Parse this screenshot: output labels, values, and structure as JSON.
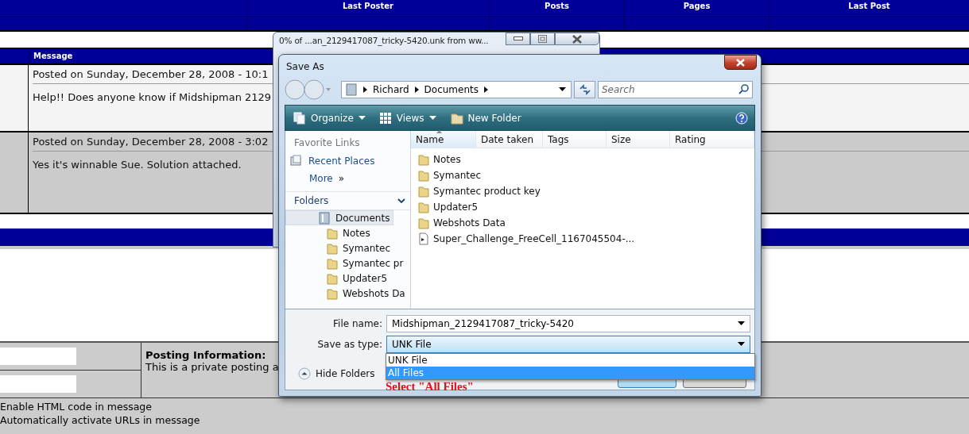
{
  "topic_table": {
    "columns": [
      "Last Poster",
      "Posts",
      "Pages",
      "Last Post"
    ]
  },
  "messages": {
    "header": "Message",
    "posts": [
      {
        "posted": "Posted on Sunday, December 28, 2008 - 10:1",
        "body": "Help!! Does anyone know if Midshipman 2129"
      },
      {
        "posted": "Posted on Sunday, December 28, 2008 - 3:02",
        "body": "Yes it's winnable Sue. Solution attached."
      }
    ]
  },
  "posting_form": {
    "info_title": "Posting Information:",
    "info_text": "This is a private posting a",
    "options": [
      "Enable HTML code in message",
      "Automatically activate URLs in message"
    ]
  },
  "download_window": {
    "title": "0% of ...an_2129417087_tricky-5420.unk from ww..."
  },
  "save_dialog": {
    "title": "Save As",
    "breadcrumb": [
      "Richard",
      "Documents"
    ],
    "search_placeholder": "Search",
    "toolbar": [
      {
        "label": "Organize",
        "dropdown": true,
        "kind": "organize"
      },
      {
        "label": "Views",
        "dropdown": true,
        "kind": "views"
      },
      {
        "label": "New Folder",
        "dropdown": false,
        "kind": "folder"
      }
    ],
    "favorite_links_title": "Favorite Links",
    "favorite_links": [
      "Recent Places"
    ],
    "more_link": "More",
    "more_glyph": "»",
    "folders_title": "Folders",
    "folders": [
      {
        "label": "Documents",
        "selected": true,
        "children": [
          {
            "label": "Notes",
            "selected": false
          },
          {
            "label": "Symantec",
            "selected": false
          },
          {
            "label": "Symantec pr",
            "selected": false
          },
          {
            "label": "Updater5",
            "selected": false
          },
          {
            "label": "Webshots Da",
            "selected": false
          }
        ]
      }
    ],
    "columns": [
      {
        "label": "Name",
        "sorted": true
      },
      {
        "label": "Date taken",
        "sorted": false
      },
      {
        "label": "Tags",
        "sorted": false
      },
      {
        "label": "Size",
        "sorted": false
      },
      {
        "label": "Rating",
        "sorted": false
      }
    ],
    "files": [
      {
        "name": "Notes",
        "kind": "folder"
      },
      {
        "name": "Symantec",
        "kind": "folder"
      },
      {
        "name": "Symantec product key",
        "kind": "folder"
      },
      {
        "name": "Updater5",
        "kind": "folder"
      },
      {
        "name": "Webshots Data",
        "kind": "folder"
      },
      {
        "name": "Super_Challenge_FreeCell_1167045504-...",
        "kind": "file"
      }
    ],
    "file_name_label": "File name:",
    "file_name": "Midshipman_2129417087_tricky-5420",
    "type_label": "Save as type:",
    "type_value": "UNK File",
    "type_options": [
      {
        "label": "UNK File",
        "selected": false
      },
      {
        "label": "All Files",
        "selected": true
      }
    ],
    "hide_folders": "Hide Folders"
  },
  "annotation": "Select \"All Files\""
}
